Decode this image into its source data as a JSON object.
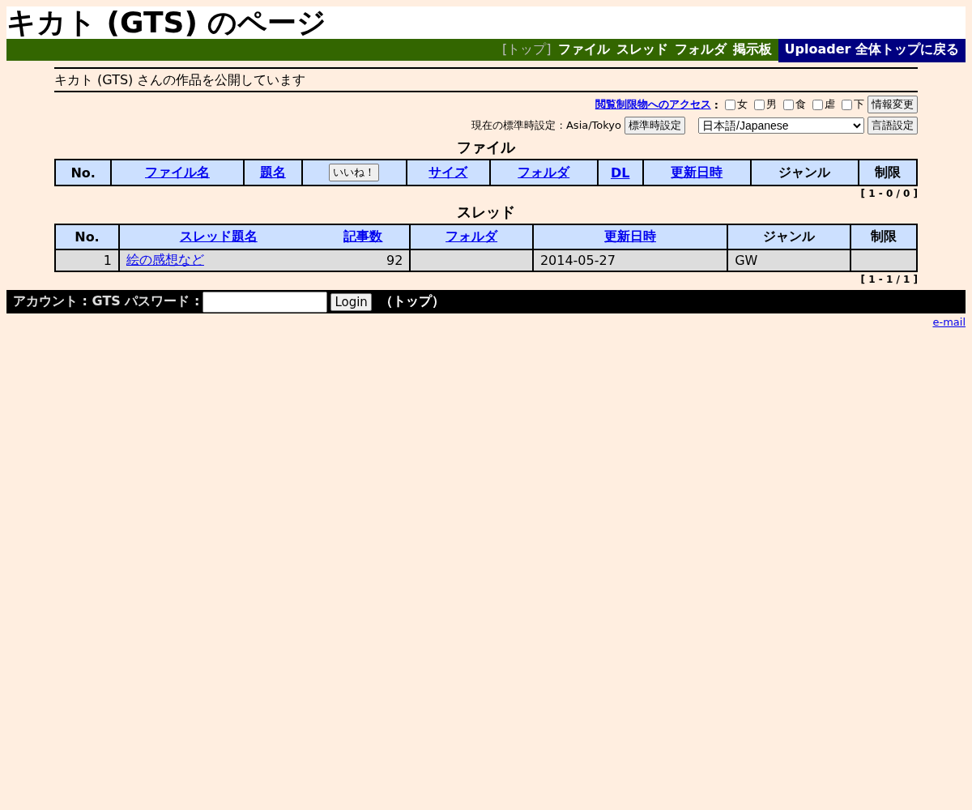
{
  "title": "キカト (GTS) のページ",
  "nav": [
    {
      "label": "[トップ]",
      "selected": true
    },
    {
      "label": "ファイル",
      "selected": false
    },
    {
      "label": "スレッド",
      "selected": false
    },
    {
      "label": "フォルダ",
      "selected": false
    },
    {
      "label": "掲示板",
      "selected": false
    }
  ],
  "nav_home": "Uploader 全体トップに戻る",
  "intro": "キカト (GTS) さんの作品を公開しています",
  "access": {
    "link": "閲覧制限物へのアクセス",
    "separator": ":",
    "options": [
      {
        "label": "女",
        "checked": false
      },
      {
        "label": "男",
        "checked": false
      },
      {
        "label": "食",
        "checked": false
      },
      {
        "label": "虐",
        "checked": false
      },
      {
        "label": "下",
        "checked": false
      }
    ],
    "button": "情報変更"
  },
  "timezone": {
    "label": "現在の標準時設定 : Asia/Tokyo",
    "button": "標準時設定",
    "language": "日本語/Japanese",
    "language_button": "言語設定"
  },
  "files": {
    "heading": "ファイル",
    "columns": [
      {
        "label": "No.",
        "kind": "plain"
      },
      {
        "label": "ファイル名",
        "kind": "link"
      },
      {
        "label": "題名",
        "kind": "link"
      },
      {
        "label": "いいね！",
        "kind": "button"
      },
      {
        "label": "サイズ",
        "kind": "link"
      },
      {
        "label": "フォルダ",
        "kind": "link"
      },
      {
        "label": "DL",
        "kind": "link"
      },
      {
        "label": "更新日時",
        "kind": "link"
      },
      {
        "label": "ジャンル",
        "kind": "plain"
      },
      {
        "label": "制限",
        "kind": "plain"
      }
    ],
    "count": "[ 1 - 0 / 0 ]"
  },
  "threads": {
    "heading": "スレッド",
    "columns": [
      {
        "label": "No.",
        "kind": "plain"
      },
      {
        "label": "スレッド題名",
        "kind": "link"
      },
      {
        "label": "記事数",
        "kind": "link"
      },
      {
        "label": "フォルダ",
        "kind": "link"
      },
      {
        "label": "更新日時",
        "kind": "link"
      },
      {
        "label": "ジャンル",
        "kind": "plain"
      },
      {
        "label": "制限",
        "kind": "plain"
      }
    ],
    "rows": [
      {
        "no": "1",
        "title": "絵の感想など",
        "posts": "92",
        "date": "2014-05-27",
        "genre": "GW"
      }
    ],
    "count": "[ 1 - 1 / 1 ]"
  },
  "login": {
    "account_label": "アカウント : GTS パスワード :",
    "button": "Login",
    "top": "（トップ）"
  },
  "email": "e-mail"
}
